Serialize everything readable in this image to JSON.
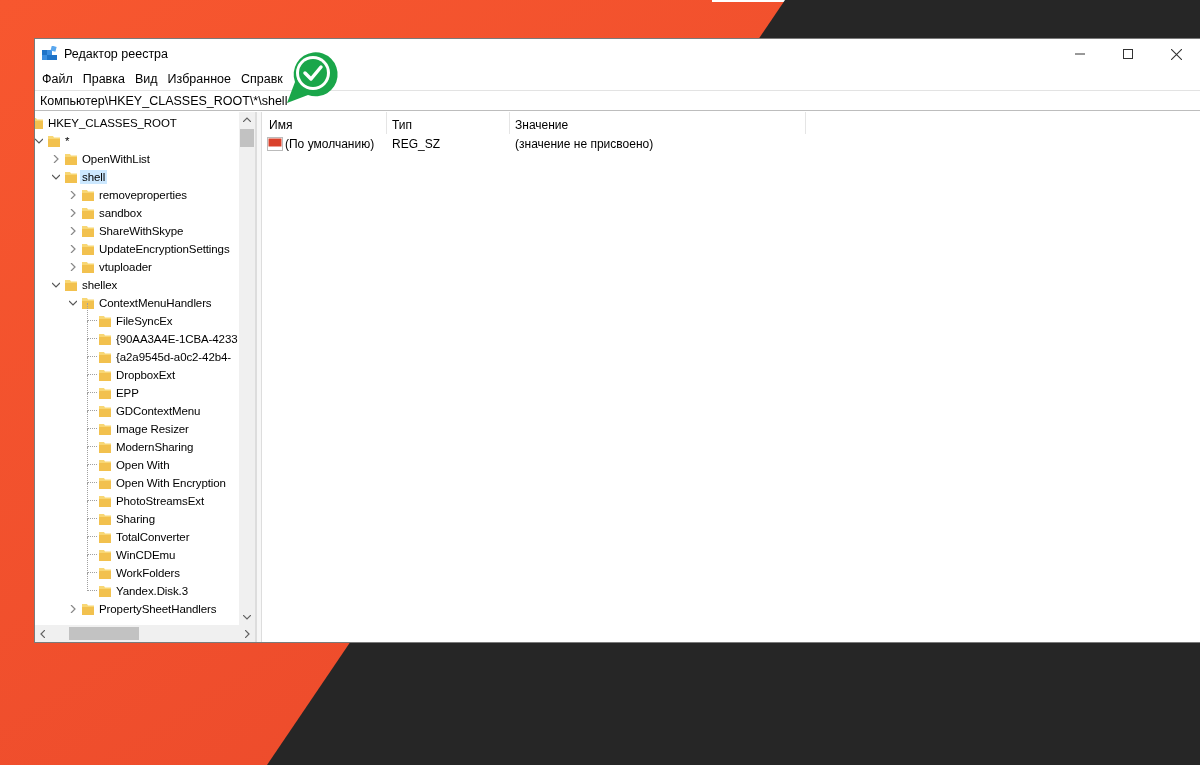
{
  "window": {
    "title": "Редактор реестра"
  },
  "menu": [
    "Файл",
    "Правка",
    "Вид",
    "Избранное",
    "Справк"
  ],
  "address": "Компьютер\\HKEY_CLASSES_ROOT\\*\\shell",
  "tree": [
    {
      "label": "HKEY_CLASSES_ROOT",
      "selected": false,
      "children": [
        {
          "label": "*",
          "selected": false,
          "expanded": true,
          "children": [
            {
              "label": "OpenWithList",
              "selected": false,
              "expanded": false
            },
            {
              "label": "shell",
              "selected": true,
              "expanded": true,
              "children": [
                {
                  "label": "removeproperties",
                  "selected": false,
                  "expanded": false
                },
                {
                  "label": "sandbox",
                  "selected": false,
                  "expanded": false
                },
                {
                  "label": "ShareWithSkype",
                  "selected": false,
                  "expanded": false
                },
                {
                  "label": "UpdateEncryptionSettings",
                  "selected": false,
                  "expanded": false
                },
                {
                  "label": "vtuploader",
                  "selected": false,
                  "expanded": false
                }
              ]
            },
            {
              "label": "shellex",
              "selected": false,
              "expanded": true,
              "children": [
                {
                  "label": "ContextMenuHandlers",
                  "selected": false,
                  "expanded": true,
                  "children": [
                    {
                      "label": " FileSyncEx",
                      "selected": false
                    },
                    {
                      "label": "{90AA3A4E-1CBA-4233",
                      "selected": false
                    },
                    {
                      "label": "{a2a9545d-a0c2-42b4-",
                      "selected": false
                    },
                    {
                      "label": "DropboxExt",
                      "selected": false
                    },
                    {
                      "label": "EPP",
                      "selected": false
                    },
                    {
                      "label": "GDContextMenu",
                      "selected": false
                    },
                    {
                      "label": "Image Resizer",
                      "selected": false
                    },
                    {
                      "label": "ModernSharing",
                      "selected": false
                    },
                    {
                      "label": "Open With",
                      "selected": false
                    },
                    {
                      "label": "Open With Encryption",
                      "selected": false
                    },
                    {
                      "label": "PhotoStreamsExt",
                      "selected": false
                    },
                    {
                      "label": "Sharing",
                      "selected": false
                    },
                    {
                      "label": "TotalConverter",
                      "selected": false
                    },
                    {
                      "label": "WinCDEmu",
                      "selected": false
                    },
                    {
                      "label": "WorkFolders",
                      "selected": false
                    },
                    {
                      "label": "Yandex.Disk.3",
                      "selected": false
                    }
                  ]
                },
                {
                  "label": "PropertySheetHandlers",
                  "selected": false,
                  "expanded": false
                }
              ]
            }
          ]
        }
      ]
    }
  ],
  "table": {
    "columns": [
      "Имя",
      "Тип",
      "Значение"
    ],
    "rows": [
      {
        "name": "(По умолчанию)",
        "type": "REG_SZ",
        "value": "(значение не присвоено)",
        "kind": "string"
      }
    ]
  }
}
